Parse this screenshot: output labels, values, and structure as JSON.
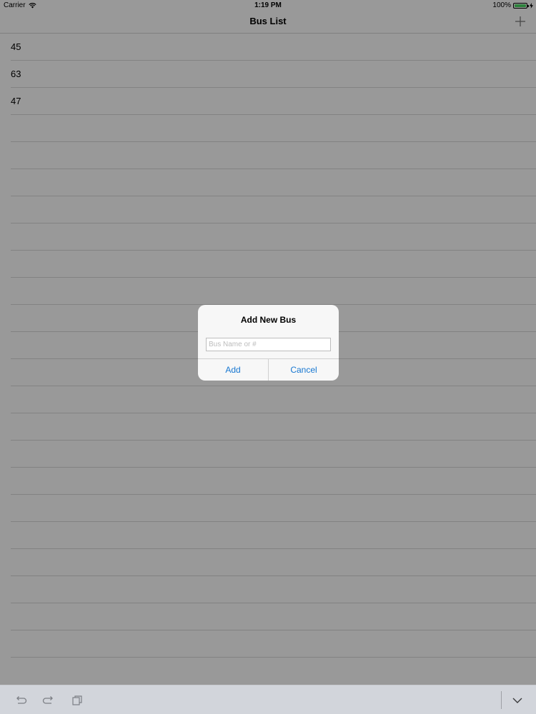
{
  "status_bar": {
    "carrier": "Carrier",
    "time": "1:19 PM",
    "battery": "100%",
    "battery_level": 1.0
  },
  "nav": {
    "title": "Bus List",
    "add_icon": "plus-icon"
  },
  "buses": [
    {
      "label": "45"
    },
    {
      "label": "63"
    },
    {
      "label": "47"
    }
  ],
  "alert": {
    "title": "Add New Bus",
    "input_placeholder": "Bus Name or #",
    "input_value": "",
    "add_label": "Add",
    "cancel_label": "Cancel"
  },
  "shortcut_bar": {
    "icons": [
      "undo-icon",
      "redo-icon",
      "paste-icon",
      "dismiss-keyboard-icon"
    ]
  },
  "colors": {
    "accent": "#1777d1",
    "battery": "#4cd964"
  }
}
